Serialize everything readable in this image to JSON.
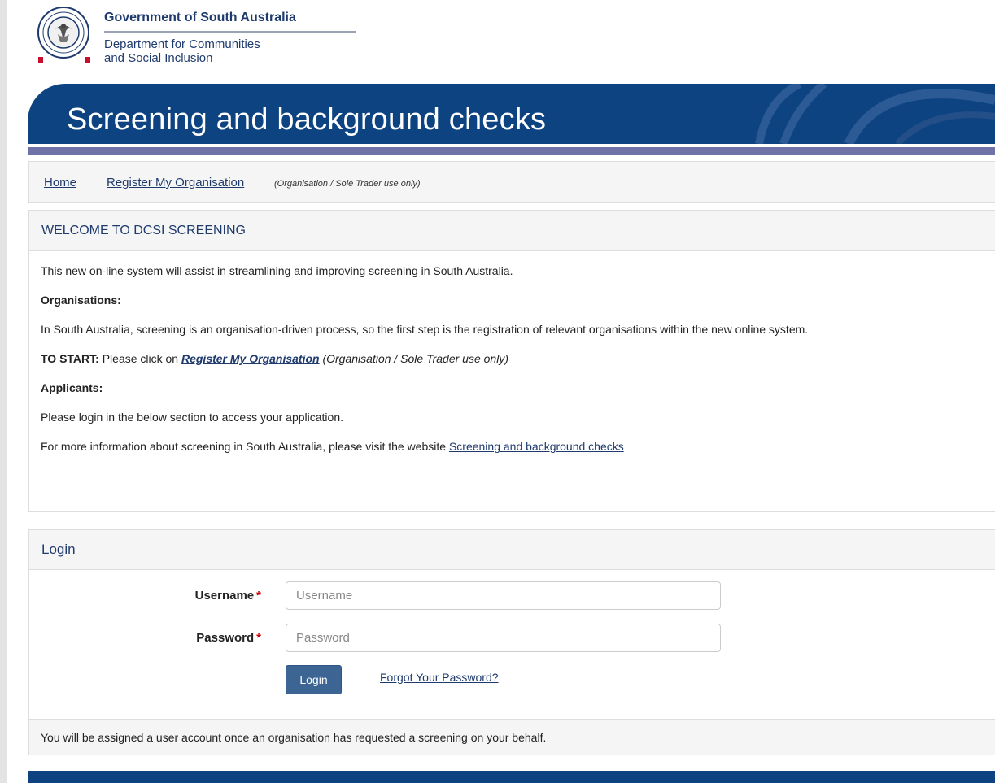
{
  "header": {
    "government": "Government of South Australia",
    "department_line1": "Department for Communities",
    "department_line2": "and Social Inclusion",
    "crest_text": "SOUTH AUSTRALIA"
  },
  "banner": {
    "title": "Screening and background checks"
  },
  "breadcrumb": {
    "home": "Home",
    "register": "Register My Organisation",
    "register_note": "(Organisation / Sole Trader use only)"
  },
  "welcome": {
    "title": "WELCOME TO DCSI SCREENING",
    "intro": "This new on-line system will assist in streamlining and improving screening in South Australia.",
    "organisations_heading": "Organisations:",
    "organisations_text": "In South Australia, screening is an organisation-driven process, so the first step is the registration of relevant organisations within the new online system.",
    "to_start_label": "TO START:",
    "to_start_text": "Please click on",
    "to_start_link": "Register My Organisation",
    "to_start_note": "(Organisation / Sole Trader use only)",
    "applicants_heading": "Applicants:",
    "applicants_text": "Please login in the below section to access your application.",
    "more_info_text": "For more information about screening in South Australia, please visit the website",
    "more_info_link": "Screening and background checks"
  },
  "login": {
    "title": "Login",
    "username_label": "Username",
    "username_placeholder": "Username",
    "username_value": "",
    "password_label": "Password",
    "password_placeholder": "Password",
    "password_value": "",
    "required_mark": "*",
    "login_button": "Login",
    "forgot_link": "Forgot Your Password?",
    "footer_note": "You will be assigned a user account once an organisation has requested a screening on your behalf."
  },
  "colors": {
    "brand_navy": "#0c4380",
    "stripe": "#6e72a6",
    "link": "#1f3b6e",
    "button": "#3d6593",
    "required": "#cc0000"
  }
}
